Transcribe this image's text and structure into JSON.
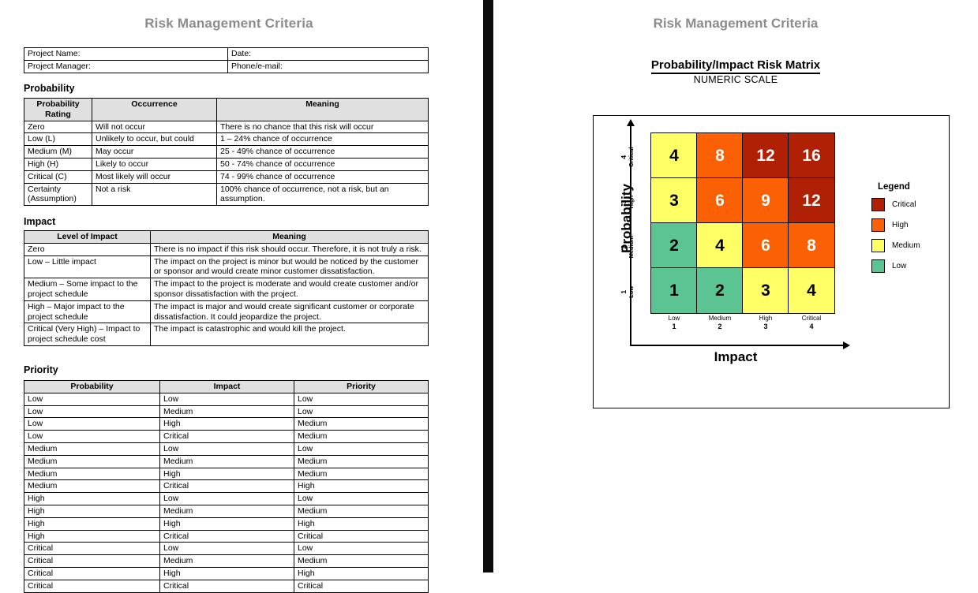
{
  "left": {
    "doc_title": "Risk Management Criteria",
    "project_info": {
      "rows": [
        {
          "label_left": "Project Name:",
          "label_right": "Date:"
        },
        {
          "label_left": "Project Manager:",
          "label_right": "Phone/e-mail:"
        }
      ]
    },
    "probability": {
      "section_label": "Probability",
      "headers": [
        "Probability Rating",
        "Occurrence",
        "Meaning"
      ],
      "rows": [
        [
          "Zero",
          "Will not occur",
          "There is no chance that this risk will occur"
        ],
        [
          "Low (L)",
          "Unlikely to occur, but could",
          "1 – 24% chance of occurrence"
        ],
        [
          "Medium (M)",
          "May occur",
          "25 - 49% chance of occurrence"
        ],
        [
          "High (H)",
          "Likely to occur",
          "50 - 74% chance of occurrence"
        ],
        [
          "Critical (C)",
          "Most likely will occur",
          "74 - 99% chance of occurrence"
        ],
        [
          "Certainty (Assumption)",
          "Not a risk",
          "100% chance of occurrence, not a risk, but an assumption."
        ]
      ]
    },
    "impact": {
      "section_label": "Impact",
      "headers": [
        "Level of Impact",
        "Meaning"
      ],
      "rows": [
        [
          "Zero",
          "There is no impact if this risk should occur.  Therefore, it is not truly a risk."
        ],
        [
          "Low – Little impact",
          "The impact on the project is minor but would be noticed by the customer or sponsor and would create minor customer dissatisfaction."
        ],
        [
          "Medium – Some impact to the project schedule",
          "The impact to the project is moderate and would create customer and/or sponsor dissatisfaction with the project."
        ],
        [
          "High – Major impact to the project schedule",
          "The impact is major and would create significant customer or corporate dissatisfaction.  It could jeopardize the project."
        ],
        [
          "Critical (Very High) – Impact to project schedule cost",
          "The impact is catastrophic and would kill the project."
        ]
      ]
    },
    "priority": {
      "section_label": "Priority",
      "headers": [
        "Probability",
        "Impact",
        "Priority"
      ],
      "rows": [
        [
          "Low",
          "Low",
          "Low"
        ],
        [
          "Low",
          "Medium",
          "Low"
        ],
        [
          "Low",
          "High",
          "Medium"
        ],
        [
          "Low",
          "Critical",
          "Medium"
        ],
        [
          "Medium",
          "Low",
          "Low"
        ],
        [
          "Medium",
          "Medium",
          "Medium"
        ],
        [
          "Medium",
          "High",
          "Medium"
        ],
        [
          "Medium",
          "Critical",
          "High"
        ],
        [
          "High",
          "Low",
          "Low"
        ],
        [
          "High",
          "Medium",
          "Medium"
        ],
        [
          "High",
          "High",
          "High"
        ],
        [
          "High",
          "Critical",
          "Critical"
        ],
        [
          "Critical",
          "Low",
          "Low"
        ],
        [
          "Critical",
          "Medium",
          "Medium"
        ],
        [
          "Critical",
          "High",
          "High"
        ],
        [
          "Critical",
          "Critical",
          "Critical"
        ]
      ]
    }
  },
  "right": {
    "doc_title": "Risk Management Criteria",
    "matrix_title": "Probability/Impact Risk Matrix",
    "matrix_subtitle": "NUMERIC SCALE",
    "legend": {
      "title": "Legend",
      "items": [
        {
          "label": "Critical",
          "color": "#b02005"
        },
        {
          "label": "High",
          "color": "#fb6104"
        },
        {
          "label": "Medium",
          "color": "#ffff66"
        },
        {
          "label": "Low",
          "color": "#5cc392"
        }
      ]
    }
  },
  "chart_data": {
    "type": "heatmap",
    "title": "Probability/Impact Risk Matrix",
    "subtitle": "NUMERIC SCALE",
    "xlabel": "Impact",
    "ylabel": "Probability",
    "x_ticks": [
      {
        "num": "1",
        "name": "Low"
      },
      {
        "num": "2",
        "name": "Medium"
      },
      {
        "num": "3",
        "name": "High"
      },
      {
        "num": "4",
        "name": "Critical"
      }
    ],
    "y_ticks": [
      {
        "num": "4",
        "name": "Critical"
      },
      {
        "num": "3",
        "name": "High"
      },
      {
        "num": "2",
        "name": "Medium"
      },
      {
        "num": "1",
        "name": "Low"
      }
    ],
    "colors": {
      "critical": "#b02005",
      "high": "#fb6104",
      "medium": "#ffff66",
      "low": "#5cc392"
    },
    "cells": [
      [
        {
          "value": "4",
          "level": "medium",
          "bg": "#ffff66",
          "fg": "#000000"
        },
        {
          "value": "8",
          "level": "high",
          "bg": "#fb6104",
          "fg": "#ffffff"
        },
        {
          "value": "12",
          "level": "critical",
          "bg": "#b02005",
          "fg": "#ffffff"
        },
        {
          "value": "16",
          "level": "critical",
          "bg": "#b02005",
          "fg": "#ffffff"
        }
      ],
      [
        {
          "value": "3",
          "level": "medium",
          "bg": "#ffff66",
          "fg": "#000000"
        },
        {
          "value": "6",
          "level": "high",
          "bg": "#fb6104",
          "fg": "#ffffff"
        },
        {
          "value": "9",
          "level": "high",
          "bg": "#fb6104",
          "fg": "#ffffff"
        },
        {
          "value": "12",
          "level": "critical",
          "bg": "#b02005",
          "fg": "#ffffff"
        }
      ],
      [
        {
          "value": "2",
          "level": "low",
          "bg": "#5cc392",
          "fg": "#000000"
        },
        {
          "value": "4",
          "level": "medium",
          "bg": "#ffff66",
          "fg": "#000000"
        },
        {
          "value": "6",
          "level": "high",
          "bg": "#fb6104",
          "fg": "#ffffff"
        },
        {
          "value": "8",
          "level": "high",
          "bg": "#fb6104",
          "fg": "#ffffff"
        }
      ],
      [
        {
          "value": "1",
          "level": "low",
          "bg": "#5cc392",
          "fg": "#000000"
        },
        {
          "value": "2",
          "level": "low",
          "bg": "#5cc392",
          "fg": "#000000"
        },
        {
          "value": "3",
          "level": "medium",
          "bg": "#ffff66",
          "fg": "#000000"
        },
        {
          "value": "4",
          "level": "medium",
          "bg": "#ffff66",
          "fg": "#000000"
        }
      ]
    ]
  }
}
